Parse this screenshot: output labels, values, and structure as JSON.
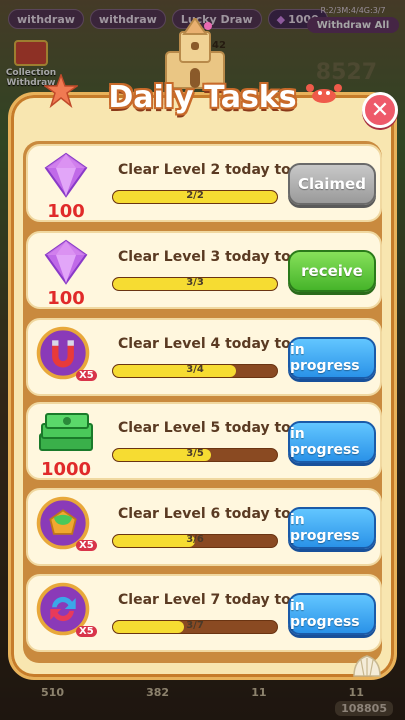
{
  "hud": {
    "withdraw_1": "withdraw",
    "withdraw_2": "withdraw",
    "lucky_draw": "Lucky Draw",
    "gems": "1000",
    "stats": "R:2/3M:4/4G:3/7",
    "withdraw_all": "Withdraw All",
    "collection": "Collection Withdraw",
    "counter": "42"
  },
  "background": {
    "score": "8527",
    "bottom_numbers": [
      "510",
      "382",
      "11",
      "11"
    ],
    "bottom_total": "108805"
  },
  "dialog": {
    "title": "Daily Tasks",
    "close_icon": "close-icon"
  },
  "tasks": [
    {
      "text": "Clear Level 2 today to",
      "progress_label": "2/2",
      "progress": 1.0,
      "reward_icon": "purple-gem-icon",
      "reward_amount": "100",
      "reward_multiplier": "",
      "button": "Claimed",
      "state": "claimed"
    },
    {
      "text": "Clear Level 3 today to",
      "progress_label": "3/3",
      "progress": 1.0,
      "reward_icon": "purple-gem-icon",
      "reward_amount": "100",
      "reward_multiplier": "",
      "button": "receive",
      "state": "receive"
    },
    {
      "text": "Clear Level 4 today to",
      "progress_label": "3/4",
      "progress": 0.75,
      "reward_icon": "magnet-icon",
      "reward_amount": "",
      "reward_multiplier": "X5",
      "button": "in progress",
      "state": "progress"
    },
    {
      "text": "Clear Level 5 today to",
      "progress_label": "3/5",
      "progress": 0.6,
      "reward_icon": "cash-stack-icon",
      "reward_amount": "1000",
      "reward_multiplier": "",
      "button": "in progress",
      "state": "progress"
    },
    {
      "text": "Clear Level 6 today to",
      "progress_label": "3/6",
      "progress": 0.5,
      "reward_icon": "paint-bucket-icon",
      "reward_amount": "",
      "reward_multiplier": "X5",
      "button": "in progress",
      "state": "progress"
    },
    {
      "text": "Clear Level 7 today to",
      "progress_label": "3/7",
      "progress": 0.43,
      "reward_icon": "shuffle-icon",
      "reward_amount": "",
      "reward_multiplier": "X5",
      "button": "in progress",
      "state": "progress"
    }
  ]
}
